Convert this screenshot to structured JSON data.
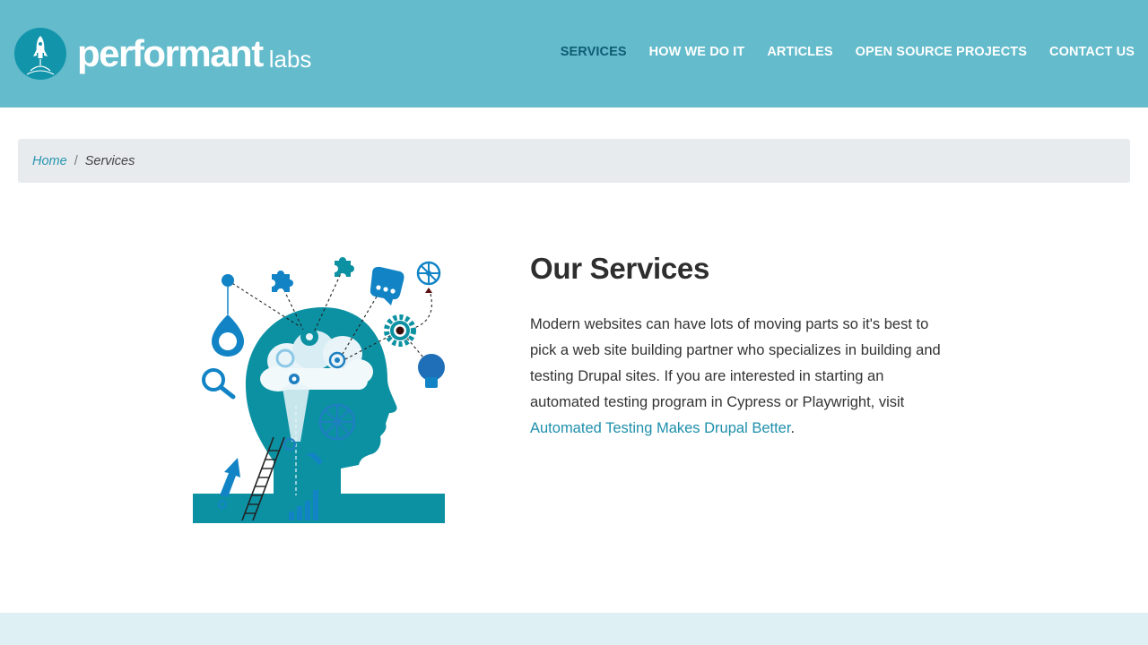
{
  "brand": {
    "name": "performant",
    "suffix": "labs",
    "header_color": "#63bbcb",
    "accent": "#1e8fac",
    "active_nav_color": "#0e5d74"
  },
  "nav": {
    "items": [
      {
        "label": "SERVICES",
        "active": true
      },
      {
        "label": "HOW WE DO IT",
        "active": false
      },
      {
        "label": "ARTICLES",
        "active": false
      },
      {
        "label": "OPEN SOURCE PROJECTS",
        "active": false
      },
      {
        "label": "CONTACT US",
        "active": false
      }
    ]
  },
  "breadcrumb": {
    "home": "Home",
    "separator": "/",
    "current": "Services"
  },
  "main": {
    "title": "Our Services",
    "body_text": "Modern websites can have lots of moving parts so it's best to pick a web site building partner who specializes in building and testing Drupal sites. If you are interested in starting an automated testing program in Cypress or Playwright, visit ",
    "link_text": "Automated Testing Makes Drupal Better",
    "after_link": ".",
    "illustration_icon": "head-ideas-illustration"
  }
}
